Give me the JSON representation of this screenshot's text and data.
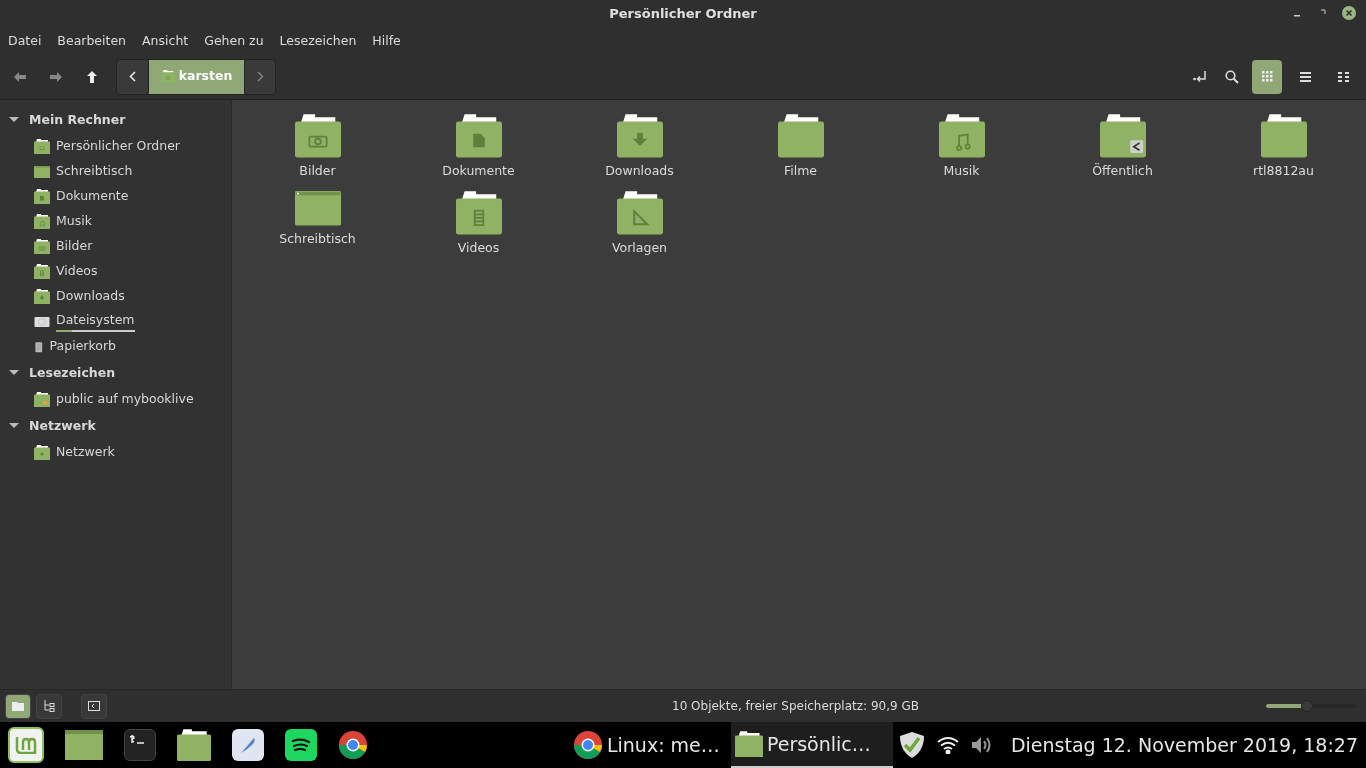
{
  "window": {
    "title": "Persönlicher Ordner"
  },
  "menu": [
    "Datei",
    "Bearbeiten",
    "Ansicht",
    "Gehen zu",
    "Lesezeichen",
    "Hilfe"
  ],
  "path": [
    {
      "label": "karsten",
      "selected": true
    }
  ],
  "views": [
    {
      "kind": "icons",
      "selected": true
    },
    {
      "kind": "list",
      "selected": false
    },
    {
      "kind": "compact",
      "selected": false
    }
  ],
  "sidebar": [
    {
      "title": "Mein Rechner",
      "expanded": true,
      "items": [
        {
          "label": "Persönlicher Ordner",
          "kind": "home"
        },
        {
          "label": "Schreibtisch",
          "kind": "desktop"
        },
        {
          "label": "Dokumente",
          "kind": "documents"
        },
        {
          "label": "Musik",
          "kind": "music"
        },
        {
          "label": "Bilder",
          "kind": "pictures"
        },
        {
          "label": "Videos",
          "kind": "videos"
        },
        {
          "label": "Downloads",
          "kind": "downloads"
        },
        {
          "label": "Dateisystem",
          "kind": "drive",
          "level": 0.2
        },
        {
          "label": "Papierkorb",
          "kind": "trash"
        }
      ]
    },
    {
      "title": "Lesezeichen",
      "expanded": true,
      "items": [
        {
          "label": "public auf mybooklive",
          "kind": "share"
        }
      ]
    },
    {
      "title": "Netzwerk",
      "expanded": true,
      "items": [
        {
          "label": "Netzwerk",
          "kind": "network"
        }
      ]
    }
  ],
  "files": [
    {
      "name": "Bilder",
      "kind": "pictures"
    },
    {
      "name": "Dokumente",
      "kind": "documents"
    },
    {
      "name": "Downloads",
      "kind": "downloads"
    },
    {
      "name": "Filme",
      "kind": "plain"
    },
    {
      "name": "Musik",
      "kind": "music"
    },
    {
      "name": "Öffentlich",
      "kind": "public"
    },
    {
      "name": "rtl8812au",
      "kind": "plain"
    },
    {
      "name": "Schreibtisch",
      "kind": "desktop"
    },
    {
      "name": "Videos",
      "kind": "videos"
    },
    {
      "name": "Vorlagen",
      "kind": "templates"
    }
  ],
  "status_bar": {
    "text": "10 Objekte, freier Speicherplatz: 90,9 GB",
    "panes": [
      {
        "kind": "places",
        "selected": true
      },
      {
        "kind": "tree",
        "selected": false
      }
    ],
    "zoom": {
      "level": 0.45
    }
  },
  "taskbar": {
    "launchers": [
      {
        "kind": "menu"
      },
      {
        "kind": "desktop"
      },
      {
        "kind": "terminal"
      },
      {
        "kind": "files"
      },
      {
        "kind": "editor"
      },
      {
        "kind": "music"
      },
      {
        "kind": "browser"
      }
    ],
    "windows": [
      {
        "label": "Linux: me…",
        "kind": "browser",
        "selected": false
      },
      {
        "label": "Persönlic…",
        "kind": "folder",
        "selected": true
      }
    ],
    "clock": "Dienstag 12. November 2019, 18:27"
  }
}
